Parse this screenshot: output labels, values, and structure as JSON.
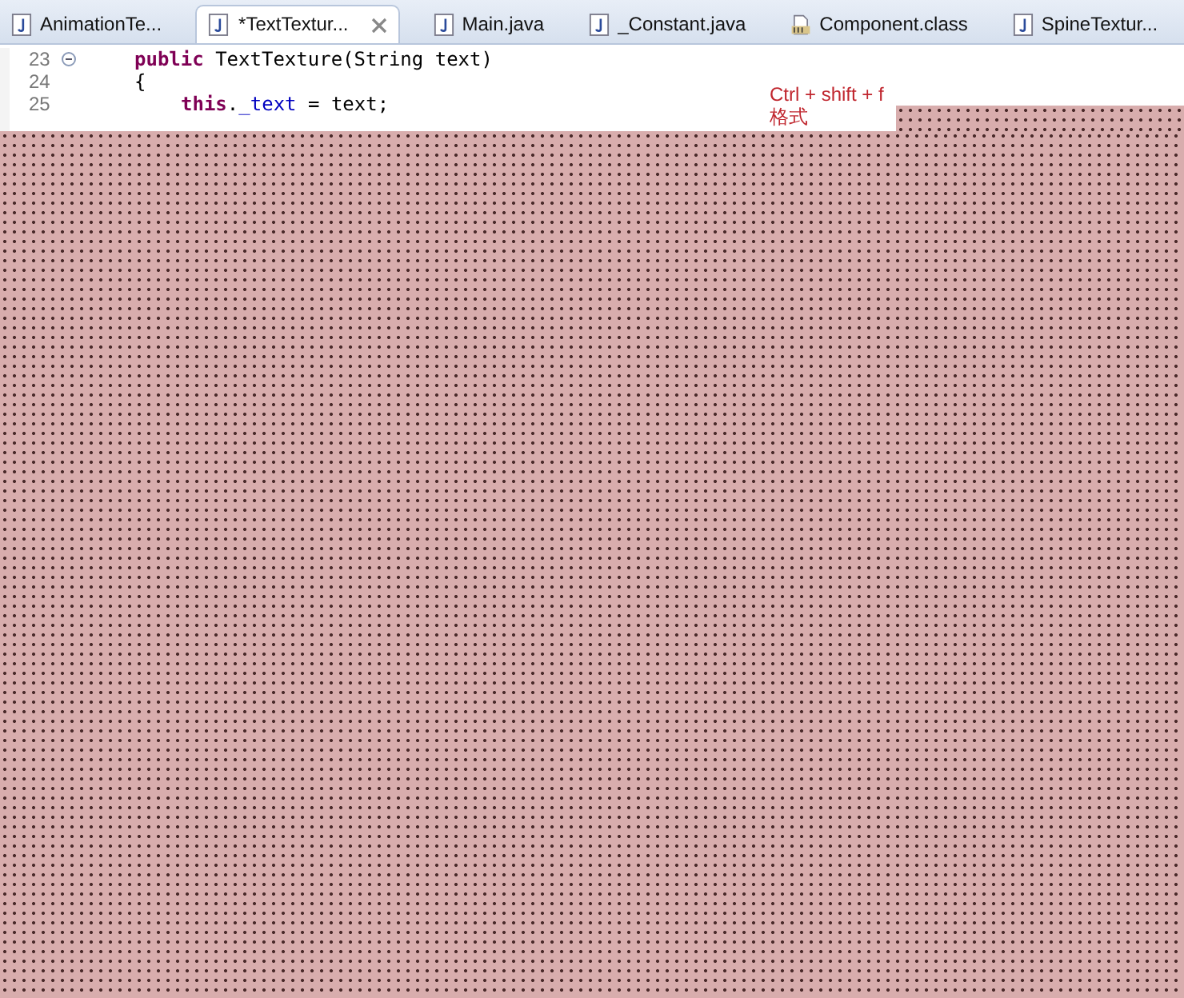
{
  "tabs": [
    {
      "label": "AnimationTe...",
      "kind": "java",
      "selected": false
    },
    {
      "label": "*TextTextur...",
      "kind": "java",
      "selected": true
    },
    {
      "label": "Main.java",
      "kind": "java",
      "selected": false
    },
    {
      "label": "_Constant.java",
      "kind": "java",
      "selected": false
    },
    {
      "label": "Component.class",
      "kind": "class",
      "selected": false
    },
    {
      "label": "SpineTextur...",
      "kind": "java",
      "selected": false
    }
  ],
  "editor": {
    "lines": [
      {
        "number": "23",
        "foldable": true,
        "segments": [
          {
            "kind": "keyword",
            "text": "public"
          },
          {
            "kind": "plain",
            "text": " TextTexture(String text)"
          }
        ]
      },
      {
        "number": "24",
        "foldable": false,
        "segments": [
          {
            "kind": "plain",
            "text": "{"
          }
        ],
        "children": [
          {
            "number": "25",
            "foldable": false,
            "segments": [
              {
                "kind": "keyword",
                "text": "this"
              },
              {
                "kind": "plain",
                "text": "."
              },
              {
                "kind": "field",
                "text": "_text"
              },
              {
                "kind": "plain",
                "text": " = text;"
              }
            ]
          }
        ]
      }
    ],
    "annotation": [
      "Ctrl + shift + f",
      "格式"
    ]
  }
}
